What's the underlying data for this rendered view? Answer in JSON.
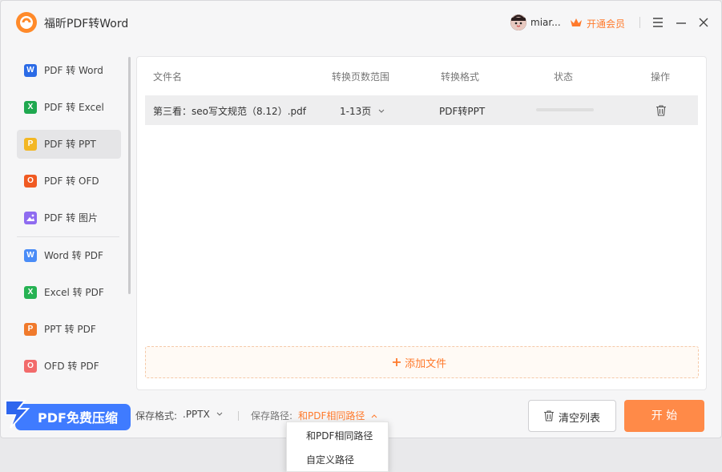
{
  "app": {
    "title": "福昕PDF转Word"
  },
  "header": {
    "username": "miar...",
    "vip_label": "开通会员"
  },
  "sidebar": {
    "items": [
      {
        "label": "PDF 转 Word",
        "icon": "W",
        "color": "#2b6be6",
        "active": false
      },
      {
        "label": "PDF 转 Excel",
        "icon": "X",
        "color": "#1fa84f",
        "active": false
      },
      {
        "label": "PDF 转 PPT",
        "icon": "P",
        "color": "#f3b724",
        "active": true
      },
      {
        "label": "PDF 转 OFD",
        "icon": "O",
        "color": "#f05a22",
        "active": false
      },
      {
        "label": "PDF 转 图片",
        "icon": "image",
        "color": "#8f6cf0",
        "active": false
      },
      {
        "label": "Word 转 PDF",
        "icon": "W",
        "color": "#4a8cf7",
        "active": false
      },
      {
        "label": "Excel 转 PDF",
        "icon": "X",
        "color": "#26b253",
        "active": false
      },
      {
        "label": "PPT 转 PDF",
        "icon": "P",
        "color": "#f07a2c",
        "active": false
      },
      {
        "label": "OFD 转 PDF",
        "icon": "O",
        "color": "#f26b6b",
        "active": false
      }
    ]
  },
  "table": {
    "headers": [
      "文件名",
      "转换页数范围",
      "转换格式",
      "状态",
      "操作"
    ],
    "rows": [
      {
        "filename": "第三看：seo写文规范（8.12）.pdf",
        "page_range": "1-13页",
        "format": "PDF转PPT",
        "progress": 0
      }
    ]
  },
  "add_file": {
    "label": "添加文件"
  },
  "footer": {
    "promo_label": "PDF免费压缩",
    "save_format_label": "保存格式:",
    "save_format_value": ".PPTX",
    "save_path_label": "保存路径:",
    "save_path_value": "和PDF相同路径",
    "clear_label": "清空列表",
    "start_label": "开 始"
  },
  "path_dropdown": {
    "options": [
      "和PDF相同路径",
      "自定义路径"
    ]
  },
  "colors": {
    "accent": "#ff7a2c",
    "start_button": "#ff8a48",
    "promo": "#3f7bff"
  }
}
